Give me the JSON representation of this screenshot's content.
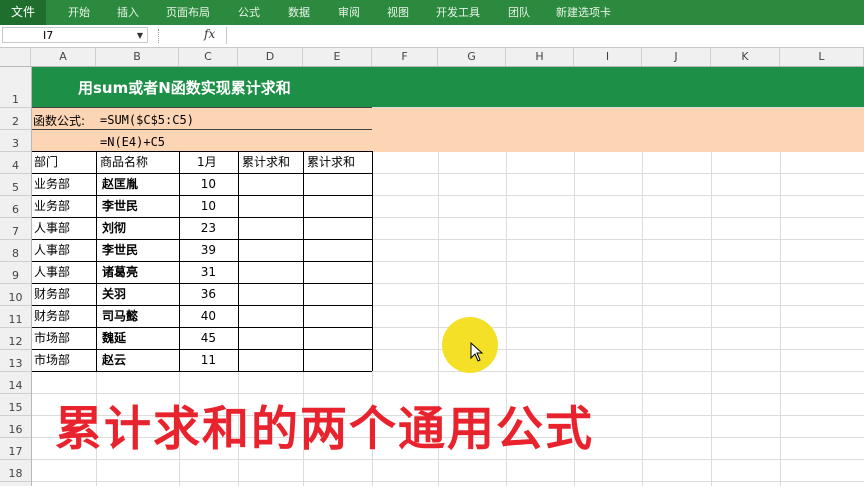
{
  "ribbon": {
    "file_tab": "文件",
    "tabs": [
      "开始",
      "插入",
      "页面布局",
      "公式",
      "数据",
      "审阅",
      "视图",
      "开发工具",
      "团队",
      "新建选项卡"
    ]
  },
  "formula_bar": {
    "name_box": "I7",
    "fx_symbol": "fx",
    "content": ""
  },
  "columns": [
    "A",
    "B",
    "C",
    "D",
    "E",
    "F",
    "G",
    "H",
    "I",
    "J",
    "K",
    "L"
  ],
  "rows": [
    "1",
    "2",
    "3",
    "4",
    "5",
    "6",
    "7",
    "8",
    "9",
    "10",
    "11",
    "12",
    "13",
    "14",
    "15",
    "16",
    "17",
    "18"
  ],
  "sheet": {
    "title": "用sum或者N函数实现累计求和",
    "formula_label": "函数公式:",
    "formula1": "=SUM($C$5:C5)",
    "formula2": "=N(E4)+C5",
    "headers": [
      "部门",
      "商品名称",
      "1月",
      "累计求和",
      "累计求和"
    ],
    "data": [
      {
        "dept": "业务部",
        "name": "赵匡胤",
        "value": "10"
      },
      {
        "dept": "业务部",
        "name": "李世民",
        "value": "10"
      },
      {
        "dept": "人事部",
        "name": "刘彻",
        "value": "23"
      },
      {
        "dept": "人事部",
        "name": "李世民",
        "value": "39"
      },
      {
        "dept": "人事部",
        "name": "诸葛亮",
        "value": "31"
      },
      {
        "dept": "财务部",
        "name": "关羽",
        "value": "36"
      },
      {
        "dept": "财务部",
        "name": "司马懿",
        "value": "40"
      },
      {
        "dept": "市场部",
        "name": "魏延",
        "value": "45"
      },
      {
        "dept": "市场部",
        "name": "赵云",
        "value": "11"
      }
    ]
  },
  "overlay_caption": "累计求和的两个通用公式",
  "colors": {
    "ribbon": "#2b8a3e",
    "title_band": "#1e8f47",
    "formula_band": "#fcd5b4",
    "caption": "#e8232d",
    "cursor_highlight": "#f3df1b"
  }
}
